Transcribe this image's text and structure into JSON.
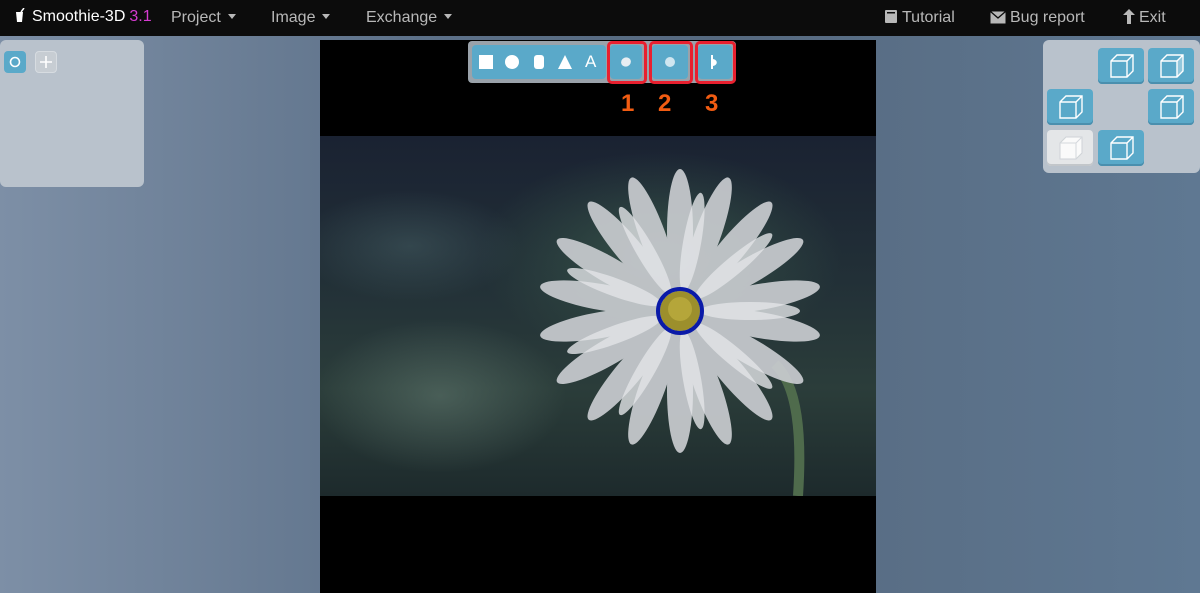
{
  "app": {
    "name": "Smoothie-3D",
    "version": "3.1",
    "version_color": "#d63bd1"
  },
  "menu": [
    {
      "label": "Project"
    },
    {
      "label": "Image"
    },
    {
      "label": "Exchange"
    }
  ],
  "right_links": [
    {
      "label": "Tutorial",
      "icon": "book-icon"
    },
    {
      "label": "Bug report",
      "icon": "envelope-icon"
    },
    {
      "label": "Exit",
      "icon": "arrow-up-icon"
    }
  ],
  "left_tools": [
    {
      "icon": "circle-select-icon",
      "active": true
    },
    {
      "icon": "move-crosshair-icon",
      "active": false
    }
  ],
  "toolbar": {
    "shapes": [
      "square-icon",
      "circle-icon",
      "rounded-rect-icon",
      "triangle-icon",
      "text-icon"
    ],
    "text_tool_label": "A",
    "highlighted": [
      {
        "number": "1",
        "icon": "smooth-blob-icon"
      },
      {
        "number": "2",
        "icon": "sphere-icon"
      },
      {
        "number": "3",
        "icon": "half-shape-icon"
      }
    ],
    "highlight_color": "#e8202f",
    "number_color": "#f25c12"
  },
  "view_cubes": [
    {
      "name": "view-front-top-icon",
      "active": false
    },
    {
      "name": "view-right-top-icon",
      "active": false
    },
    {
      "name": "view-left-icon",
      "active": false
    },
    {
      "name": "view-right-icon",
      "active": false
    },
    {
      "name": "view-solid-icon",
      "active": true
    },
    {
      "name": "view-bottom-icon",
      "active": false
    }
  ],
  "colors": {
    "accent": "#5aa9c9",
    "topbar": "#0c0c0c",
    "outline": "#0a1aa8"
  }
}
